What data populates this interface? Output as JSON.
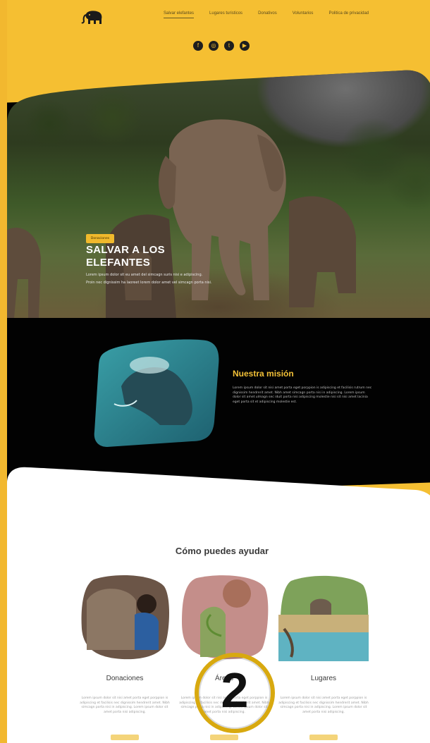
{
  "header": {
    "nav": [
      {
        "label": "Salvar elefantes",
        "active": true
      },
      {
        "label": "Lugares turisticos",
        "active": false
      },
      {
        "label": "Donativos",
        "active": false
      },
      {
        "label": "Voluntarios",
        "active": false
      },
      {
        "label": "Politica de privacidad",
        "active": false
      }
    ],
    "social": [
      {
        "icon": "facebook-icon",
        "glyph": "f"
      },
      {
        "icon": "instagram-icon",
        "glyph": "◎"
      },
      {
        "icon": "twitter-icon",
        "glyph": "t"
      },
      {
        "icon": "youtube-icon",
        "glyph": "▶"
      }
    ]
  },
  "hero": {
    "title": "SALVAR A LOS\nELEFANTES",
    "line1": "Lorem ipsum dolor sit eu amet del simcagn suris nisi e adipiscing.",
    "line2": "Proin nec dignissim ha laoreet lorem dolor amet vel simcagn porta nisi.",
    "button": "Donaciones"
  },
  "mission": {
    "title": "Nuestra misión",
    "body": "Lorem ipsum dolor sit nisi amet porta eget porppion is adipiscing et facilisis rutrum nec dignissim hendrerit amet. Nibh amet simcagn porta nisi in adipiscing. Lorem ipsum dolor sit amet ulmagn sec iduit porta nisi adipiscing molestie nisi sit nisi amet lacinia eget porta sit et adipiscing molestie est."
  },
  "help": {
    "title": "Cómo puedes ayudar",
    "cards": [
      {
        "label": "Donaciones",
        "text": "Lorem ipsum dolor sit nisi amet porta eget porppion is adipiscing et facilisis nec dignissim hendrerit amet. Nibh simcagn porta nisi in adipiscing. Lorem ipsum dolor sit amet porta nisi adipiscing."
      },
      {
        "label": "Áreas",
        "text": "Lorem ipsum dolor sit nisi amet porta eget porppion is adipiscing et facilisis nec dignissim hendrerit amet. Nibh simcagn porta nisi in adipiscing. Lorem ipsum dolor sit amet porta nisi adipiscing."
      },
      {
        "label": "Lugares",
        "text": "Lorem ipsum dolor sit nisi amet porta eget porppion is adipiscing et facilisis nec dignissim hendrerit amet. Nibh simcagn porta nisi in adipiscing. Lorem ipsum dolor sit amet porta nisi adipiscing."
      }
    ]
  },
  "overlay": {
    "step_number": "2"
  },
  "colors": {
    "accent": "#f5bf32",
    "dark": "#020202",
    "mission_title": "#f2c037"
  }
}
